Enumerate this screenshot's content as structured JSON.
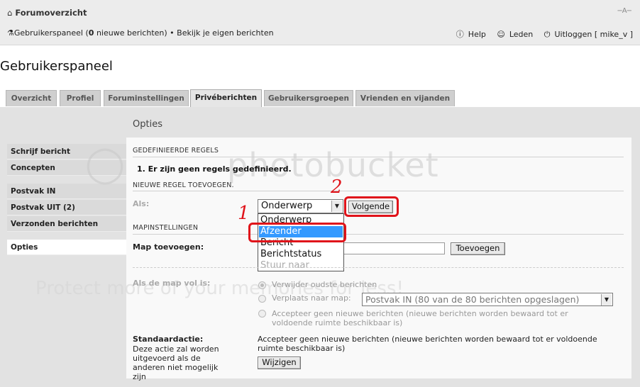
{
  "header": {
    "breadcrumb": "Forumoverzicht",
    "resize_icon": "font-resize-icon",
    "resize_label": "A",
    "user_panel_link": "Gebruikerspaneel",
    "new_messages_count": "0",
    "new_messages_label": "nieuwe berichten",
    "view_own_posts": "Bekijk je eigen berichten",
    "help": "Help",
    "members": "Leden",
    "logout": "Uitloggen [ mike_v ]"
  },
  "page_title": "Gebruikerspaneel",
  "tabs": [
    {
      "label": "Overzicht"
    },
    {
      "label": "Profiel"
    },
    {
      "label": "Foruminstellingen"
    },
    {
      "label": "Privéberichten",
      "active": true
    },
    {
      "label": "Gebruikersgroepen"
    },
    {
      "label": "Vrienden en vijanden"
    }
  ],
  "section_title": "Opties",
  "sidebar": {
    "items": [
      {
        "label": "Schrijf bericht"
      },
      {
        "label": "Concepten"
      },
      {
        "label": "Postvak IN"
      },
      {
        "label": "Postvak UIT (2)"
      },
      {
        "label": "Verzonden berichten"
      },
      {
        "label": "Opties",
        "active": true
      }
    ]
  },
  "rules": {
    "heading": "GEDEFINIEERDE REGELS",
    "empty_text": "1. Er zijn geen regels gedefinieerd.",
    "new_heading": "NIEUWE REGEL TOEVOEGEN.",
    "as_label": "Als:",
    "select_value": "Onderwerp",
    "next_button": "Volgende",
    "options": [
      "Onderwerp",
      "Afzender",
      "Bericht",
      "Berichtstatus",
      "Stuur naar"
    ],
    "selected_option": "Afzender"
  },
  "folders": {
    "heading": "MAPINSTELLINGEN",
    "add_label": "Map toevoegen:",
    "add_value": "",
    "add_button": "Toevoegen",
    "full_label": "Als de map vol is:",
    "opt_delete": "Verwijder oudste berichten",
    "opt_move": "Verplaats naar map:",
    "move_select": "Postvak IN (80 van de 80 berichten opgeslagen)",
    "opt_reject": "Accepteer geen nieuwe berichten (nieuwe berichten worden bewaard tot er voldoende ruimte beschikbaar is)"
  },
  "default_action": {
    "title": "Standaardactie:",
    "description": "Deze actie zal worden uitgevoerd als de anderen niet mogelijk zijn",
    "value": "Accepteer geen nieuwe berichten (nieuwe berichten worden bewaard tot er voldoende ruimte beschikbaar is)",
    "change_button": "Wijzigen"
  },
  "annotations": {
    "marker_1": "1",
    "marker_2": "2",
    "color": "#e0131a"
  },
  "watermark": {
    "line1": "photobucket",
    "line2": "Protect more of your memories for less!"
  },
  "colors": {
    "selected_option": "#3399ff",
    "panel": "#e2e2e2",
    "content": "#f9f9f9"
  }
}
